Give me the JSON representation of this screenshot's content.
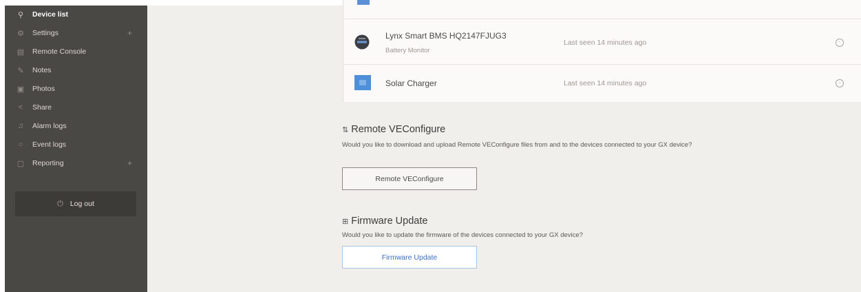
{
  "sidebar": {
    "items": [
      {
        "label": "Device list",
        "icon": "map-pin-icon",
        "active": true,
        "expandable": false
      },
      {
        "label": "Settings",
        "icon": "gear-icon",
        "active": false,
        "expandable": true,
        "plus": "+"
      },
      {
        "label": "Remote Console",
        "icon": "monitor-icon",
        "active": false,
        "expandable": false
      },
      {
        "label": "Notes",
        "icon": "pencil-icon",
        "active": false,
        "expandable": false
      },
      {
        "label": "Photos",
        "icon": "image-icon",
        "active": false,
        "expandable": false
      },
      {
        "label": "Share",
        "icon": "share-icon",
        "active": false,
        "expandable": false
      },
      {
        "label": "Alarm logs",
        "icon": "bell-icon",
        "active": false,
        "expandable": false
      },
      {
        "label": "Event logs",
        "icon": "circle-icon",
        "active": false,
        "expandable": false
      },
      {
        "label": "Reporting",
        "icon": "document-icon",
        "active": false,
        "expandable": true,
        "plus": "+"
      }
    ],
    "logout_label": "Log out"
  },
  "devices": [
    {
      "name": "Lynx Smart BMS HQ2147FJUG3",
      "subtitle": "Battery Monitor",
      "last_seen": "Last seen 14 minutes ago",
      "icon": "battery-monitor-icon"
    },
    {
      "name": "Solar Charger",
      "subtitle": "",
      "last_seen": "Last seen 14 minutes ago",
      "icon": "solar-charger-icon"
    }
  ],
  "veconfigure": {
    "title": "Remote VEConfigure",
    "description": "Would you like to download and upload Remote VEConfigure files from and to the devices connected to your GX device?",
    "button_label": "Remote VEConfigure"
  },
  "firmware": {
    "title": "Firmware Update",
    "description": "Would you like to update the firmware of the devices connected to your GX device?",
    "button_label": "Firmware Update"
  },
  "colors": {
    "sidebar_bg": "#4a4845",
    "page_bg": "#f1efec",
    "accent_blue": "#3a6fc4"
  }
}
